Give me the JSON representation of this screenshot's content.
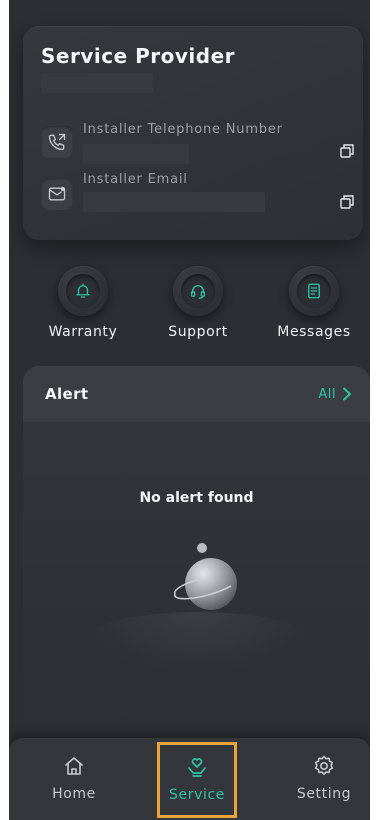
{
  "provider": {
    "title": "Service Provider",
    "phone_label": "Installer Telephone Number",
    "email_label": "Installer Email"
  },
  "actions": [
    {
      "label": "Warranty",
      "icon": "bell-icon"
    },
    {
      "label": "Support",
      "icon": "headset-icon"
    },
    {
      "label": "Messages",
      "icon": "document-icon"
    }
  ],
  "alert": {
    "title": "Alert",
    "all_label": "All",
    "empty_text": "No alert found"
  },
  "nav": [
    {
      "label": "Home",
      "icon": "home-icon",
      "active": false
    },
    {
      "label": "Service",
      "icon": "heart-hand-icon",
      "active": true
    },
    {
      "label": "Setting",
      "icon": "gear-icon",
      "active": false
    }
  ],
  "colors": {
    "background": "#2b2e33",
    "accent": "#2ec4a6",
    "highlight_outline": "#e8a33d",
    "text": "#f3f5f7",
    "muted_text": "#9aa0a6"
  }
}
